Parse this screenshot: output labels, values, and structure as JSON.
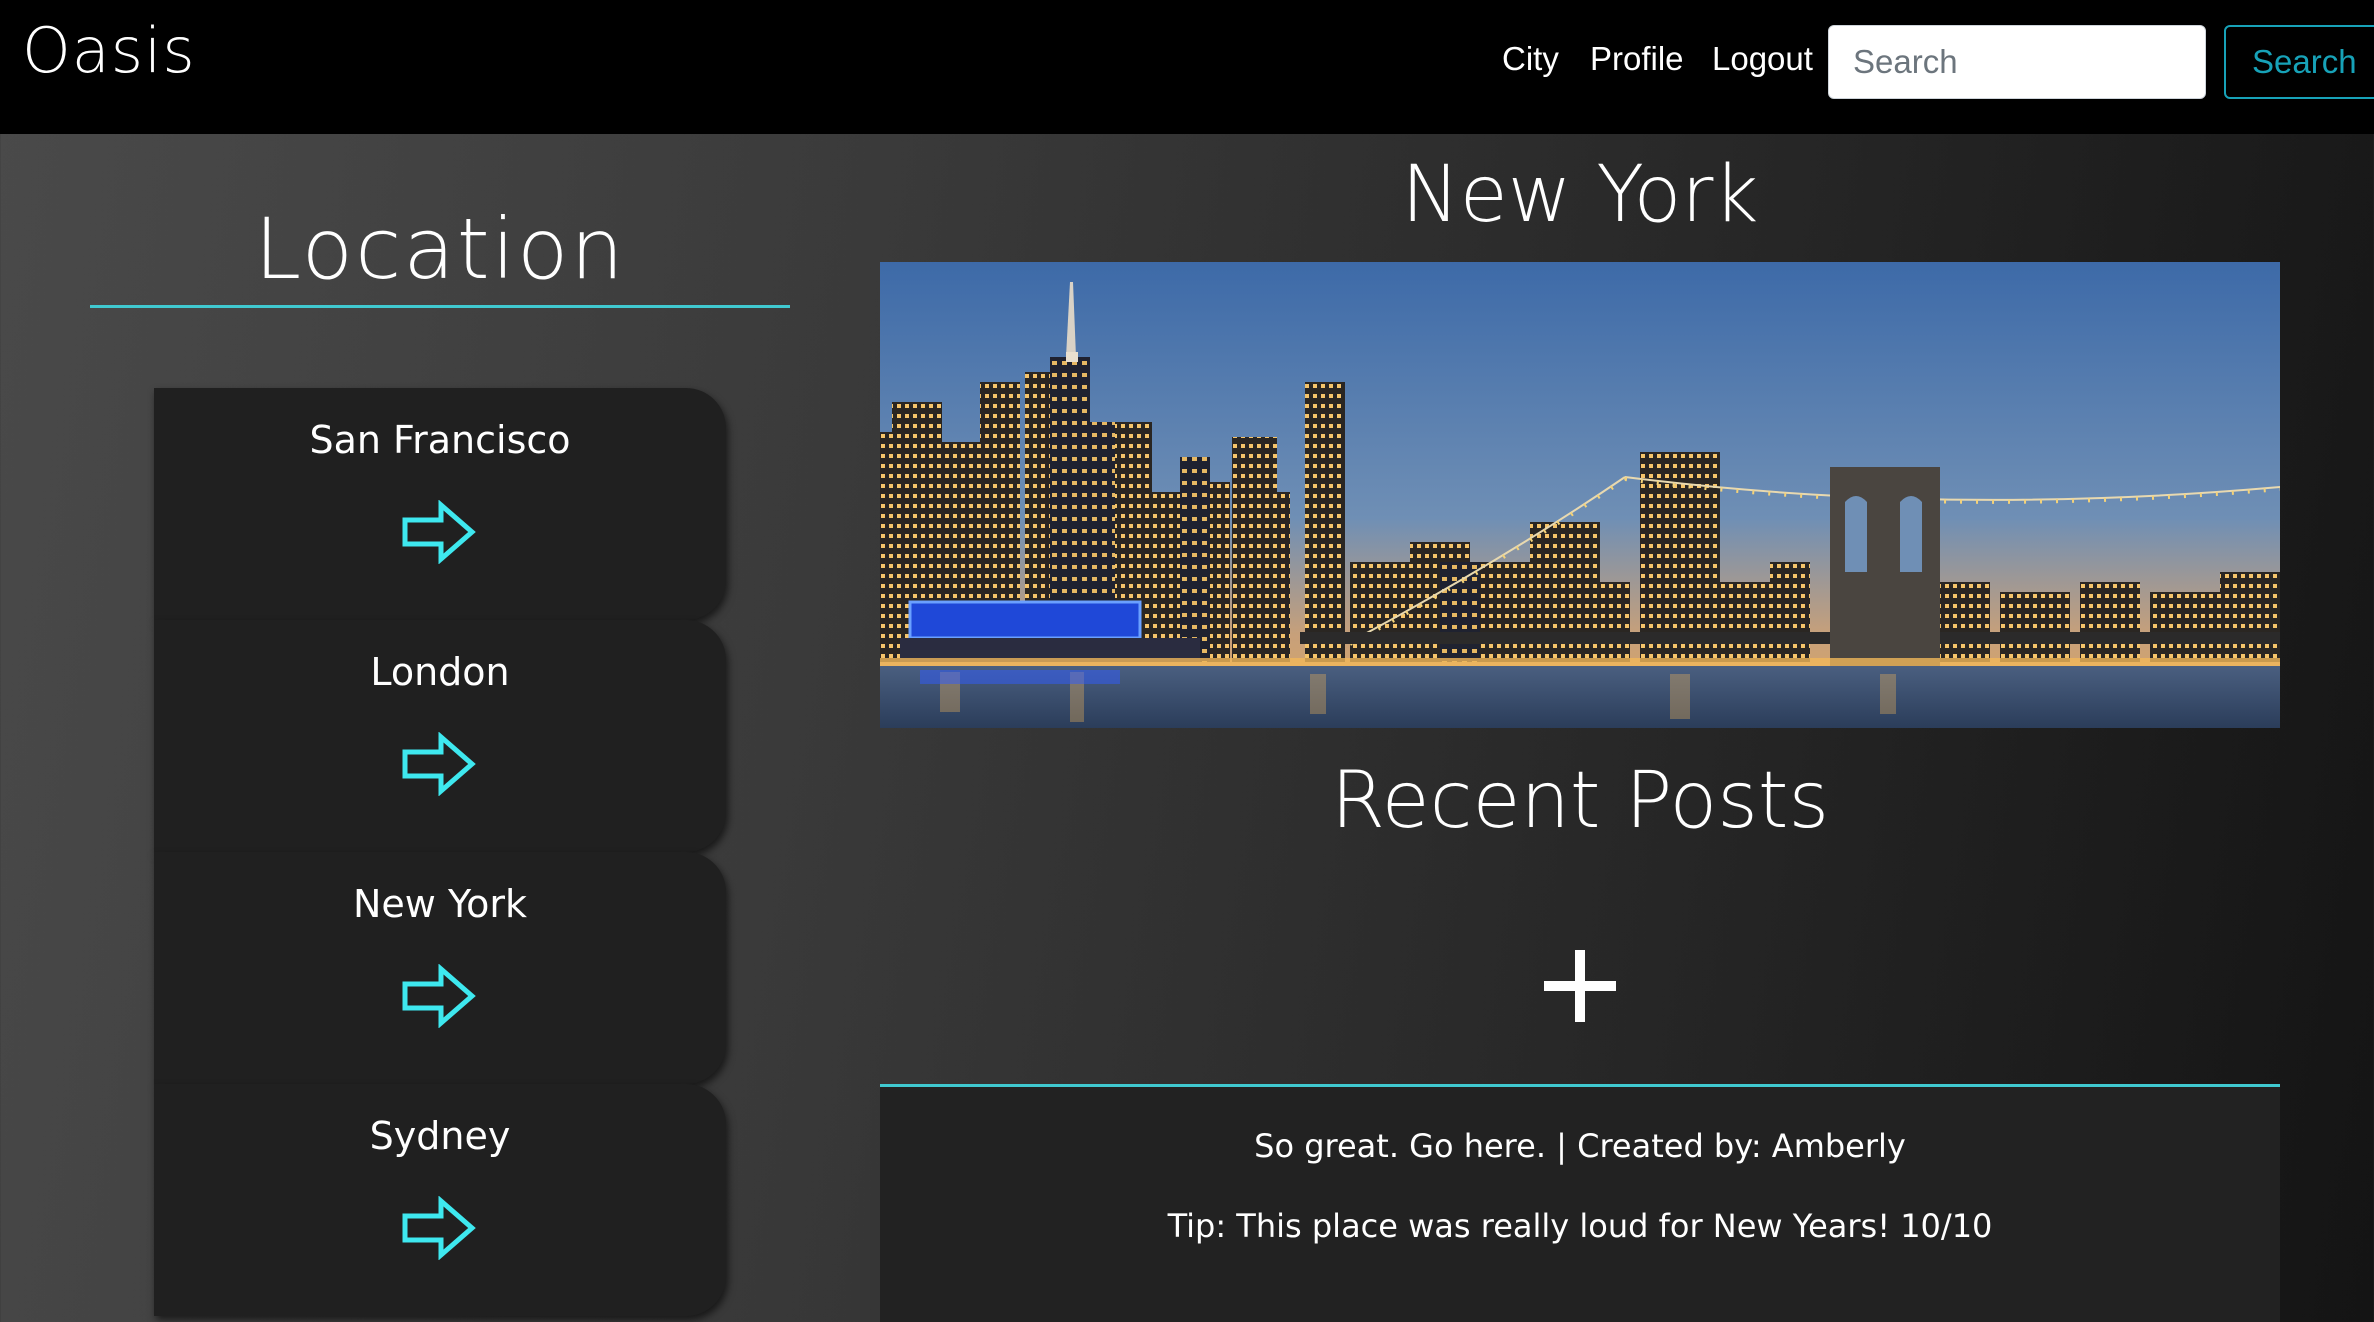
{
  "navbar": {
    "brand": "Oasis",
    "links": [
      "City",
      "Profile",
      "Logout"
    ],
    "search_placeholder": "Search",
    "search_button": "Search"
  },
  "sidebar": {
    "title": "Location",
    "cities": [
      "San Francisco",
      "London",
      "New York",
      "Sydney"
    ],
    "arrow_icon": "right-arrow-icon"
  },
  "main": {
    "city_title": "New York",
    "posts_title": "Recent Posts",
    "add_icon": "plus-icon",
    "posts": [
      {
        "line1": "So great. Go here. | Created by: Amberly",
        "line2": "Tip: This place was really loud for New Years! 10/10"
      }
    ]
  },
  "colors": {
    "accent": "#40c9d0",
    "search_button": "#17a2b8",
    "navbar": "#000000",
    "card": "#202020"
  }
}
